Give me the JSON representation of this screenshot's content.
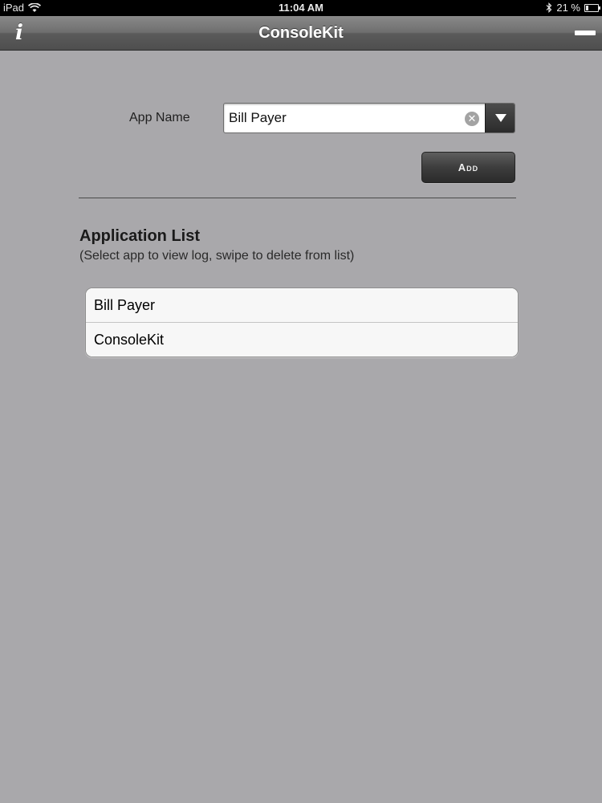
{
  "status_bar": {
    "device": "iPad",
    "time": "11:04 AM",
    "battery": "21 %"
  },
  "nav_bar": {
    "title": "ConsoleKit",
    "info_glyph": "i"
  },
  "form": {
    "app_name_label": "App Name",
    "app_name_value": "Bill Payer",
    "add_label": "Add"
  },
  "app_list": {
    "title": "Application List",
    "subtitle": "(Select app to view log, swipe to delete from list)",
    "items": [
      {
        "label": "Bill Payer"
      },
      {
        "label": "ConsoleKit"
      }
    ]
  },
  "icons": {
    "wifi": "wifi-icon",
    "bluetooth": "bluetooth-icon",
    "battery": "battery-icon",
    "info": "info-icon",
    "minus": "minus-icon",
    "clear": "clear-icon",
    "dropdown": "triangle-down-icon"
  },
  "colors": {
    "background": "#a9a8ab",
    "nav_bar": "#6f6f6f",
    "button_dark": "#3d3d3d"
  }
}
